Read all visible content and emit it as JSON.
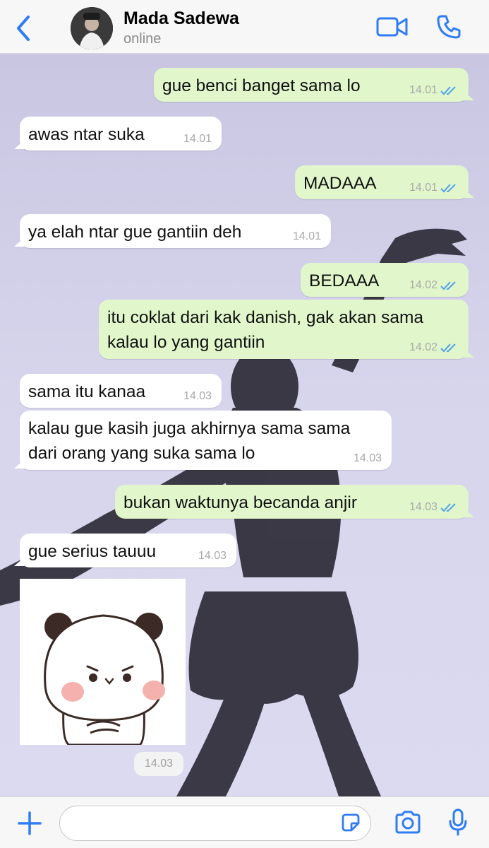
{
  "header": {
    "back_icon": "chevron-left-icon",
    "contact_name": "Mada Sadewa",
    "status": "online",
    "video_icon": "video-call-icon",
    "call_icon": "phone-icon",
    "accent_color": "#2f7cf6"
  },
  "messages": [
    {
      "dir": "out",
      "text": "gue benci banget sama lo",
      "time": "14.01",
      "read": true
    },
    {
      "dir": "in",
      "text": "awas ntar suka",
      "time": "14.01"
    },
    {
      "dir": "out",
      "text": "MADAAA",
      "time": "14.01",
      "read": true
    },
    {
      "dir": "in",
      "text": "ya elah ntar gue gantiin deh",
      "time": "14.01"
    },
    {
      "dir": "out",
      "text": "BEDAAA",
      "time": "14.02",
      "read": true
    },
    {
      "dir": "out",
      "text": "itu coklat dari kak danish, gak akan sama",
      "text2": "kalau lo yang gantiin",
      "time": "14.02",
      "read": true
    },
    {
      "dir": "in",
      "text": "sama itu kanaa",
      "time": "14.03"
    },
    {
      "dir": "in",
      "text": "kalau gue kasih juga akhirnya sama sama",
      "text2": "dari orang yang suka sama lo",
      "time": "14.03"
    },
    {
      "dir": "out",
      "text": "bukan waktunya becanda anjir",
      "time": "14.03",
      "read": true
    },
    {
      "dir": "in",
      "text": "gue serius tauuu",
      "time": "14.03"
    }
  ],
  "sticker": {
    "description_icon": "panda-sticker-icon",
    "time": "14.03"
  },
  "input_bar": {
    "plus_icon": "plus-icon",
    "message_value": "",
    "sticker_icon": "sticker-icon",
    "camera_icon": "camera-icon",
    "mic_icon": "microphone-icon"
  },
  "colors": {
    "outgoing_bubble": "#e1f7cb",
    "incoming_bubble": "#ffffff",
    "read_ticks": "#4fa3e8"
  }
}
